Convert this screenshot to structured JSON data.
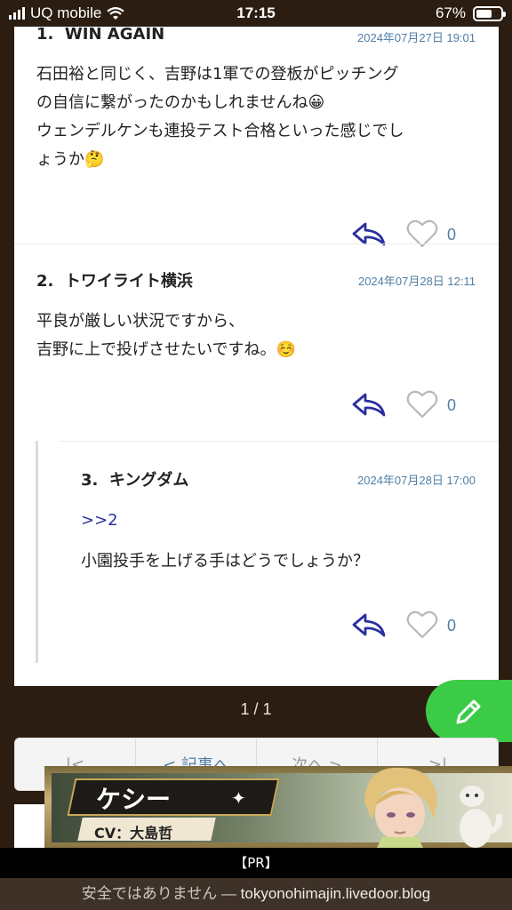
{
  "status_bar": {
    "carrier": "UQ mobile",
    "time": "17:15",
    "battery": "67%",
    "battery_level": 0.67
  },
  "comments": [
    {
      "number": "1.",
      "name": "WIN AGAIN",
      "date": "2024年07月27日 19:01",
      "body": "石田裕と同じく、吉野は1軍での登板がピッチング\nの自信に繋がったのかもしれませんね😀\nウェンデルケンも連投テスト合格といった感じでし\nょうか🤔",
      "likes": "0"
    },
    {
      "number": "2.",
      "name": "トワイライト横浜",
      "date": "2024年07月28日 12:11",
      "body": "平良が厳しい状況ですから、\n吉野に上で投げさせたいですね。☺️",
      "likes": "0"
    },
    {
      "number": "3.",
      "name": "キングダム",
      "date": "2024年07月28日 17:00",
      "anchor": ">>2",
      "body": "小園投手を上げる手はどうでしょうか？",
      "likes": "0"
    }
  ],
  "pager": {
    "count": "1 / 1",
    "first": "|<",
    "prev_article": "< 記事へ",
    "next": "次へ >",
    "last": ">|"
  },
  "ad": {
    "name": "ケシー",
    "cv": "CV：大島哲",
    "pr_label": "【PR】"
  },
  "url_bar": {
    "warning": "安全ではありません — ",
    "host": "tokyonohimajin.livedoor.blog"
  },
  "colors": {
    "background": "#2b1d12",
    "accent": "#3ccb46",
    "link": "#4f7fa6",
    "icon": "#2b2f9f"
  }
}
